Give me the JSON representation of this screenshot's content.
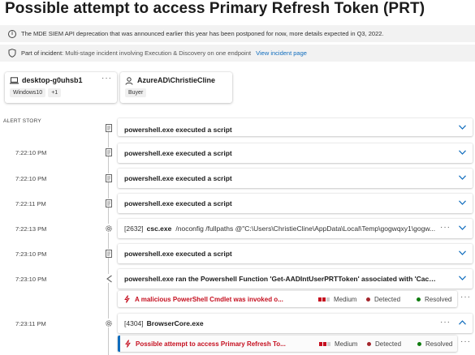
{
  "title": "Possible attempt to access Primary Refresh Token (PRT)",
  "banners": {
    "deprecation": {
      "icon": "info-icon",
      "text": "The MDE SIEM API deprecation that was announced earlier this year has been postponed for now, more details expected in Q3, 2022."
    },
    "incident": {
      "icon": "shield-icon",
      "prefix": "Part of incident:",
      "text": "Multi-stage incident involving Execution & Discovery on one endpoint",
      "link": "View incident page"
    }
  },
  "entities": [
    {
      "icon": "laptop-icon",
      "name": "desktop-g0uhsb1",
      "tags": [
        "Windows10",
        "+1"
      ],
      "more": "···"
    },
    {
      "icon": "user-icon",
      "name": "AzureAD\\ChristieCline",
      "tags": [
        "Buyer"
      ],
      "more": "···"
    }
  ],
  "alert_story_label": "ALERT STORY",
  "events": {
    "e0": {
      "label": "powershell.exe executed a script"
    },
    "e1": {
      "time": "7:22:10 PM",
      "label": "powershell.exe executed a script"
    },
    "e2": {
      "time": "7:22:10 PM",
      "label": "powershell.exe executed a script"
    },
    "e3": {
      "time": "7:22:11 PM",
      "label": "powershell.exe executed a script"
    },
    "e4": {
      "time": "7:22:13 PM",
      "pid": "[2632]",
      "proc": "csc.exe",
      "args": "/noconfig /fullpaths @\"C:\\Users\\ChristieCline\\AppData\\Local\\Temp\\gogwqxy1\\gogw...",
      "more": "···"
    },
    "e5": {
      "time": "7:23:10 PM",
      "label": "powershell.exe executed a script"
    },
    "e6": {
      "time": "7:23:10 PM",
      "label": "powershell.exe ran the Powershell Function 'Get-AADIntUserPRTToken' associated with 'Cached D..."
    },
    "e7": {
      "time": "7:23:11 PM",
      "pid": "[4304]",
      "proc": "BrowserCore.exe",
      "more": "···"
    }
  },
  "alerts": {
    "a1": {
      "title": "A malicious PowerShell Cmdlet was invoked o...",
      "severity": "Medium",
      "detection": "Detected",
      "status": "Resolved",
      "more": "···"
    },
    "a2": {
      "title": "Possible attempt to access Primary Refresh To...",
      "severity": "Medium",
      "detection": "Detected",
      "status": "Resolved",
      "more": "···"
    }
  },
  "colors": {
    "accent": "#0f6cbd",
    "alert_red": "#c50f1f",
    "detected": "#a4262c",
    "resolved": "#107c10"
  }
}
